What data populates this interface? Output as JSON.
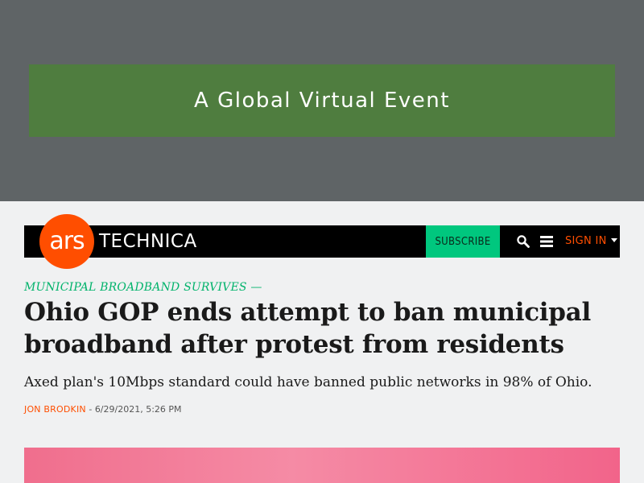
{
  "ad": {
    "text": "A Global Virtual Event"
  },
  "header": {
    "logo_ars": "ars",
    "logo_technica": "TECHNICA",
    "subscribe_label": "SUBSCRIBE",
    "signin_label": "SIGN IN"
  },
  "article": {
    "kicker": "MUNICIPAL BROADBAND SURVIVES —",
    "headline": "Ohio GOP ends attempt to ban municipal broadband after protest from residents",
    "dek": "Axed plan's 10Mbps standard could have banned public networks in 98% of Ohio.",
    "author": "JON BRODKIN",
    "separator": " - ",
    "date": "6/29/2021, 5:26 PM"
  },
  "colors": {
    "brand": "#ff4e00",
    "subscribe": "#00c77e",
    "kicker": "#00b36b",
    "ad_banner": "#4f7d3f",
    "ad_area": "#5f6466"
  },
  "icons": [
    "search-icon",
    "menu-icon",
    "chevron-down-icon"
  ]
}
